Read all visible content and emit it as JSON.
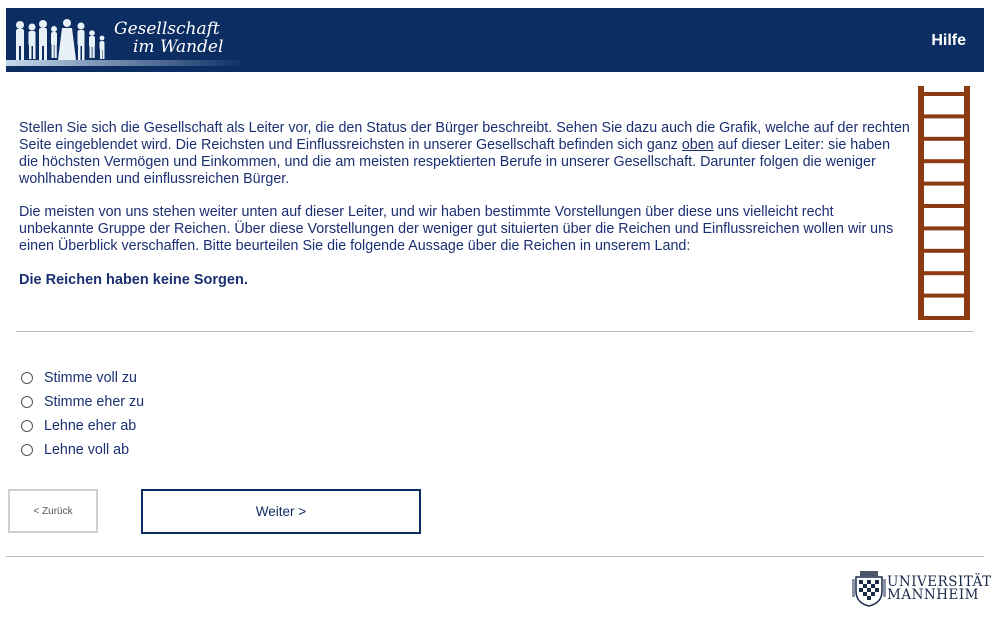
{
  "header": {
    "logo_line1": "Gesellschaft",
    "logo_line2": "im Wandel",
    "help_label": "Hilfe",
    "background_color": "#0c2d62"
  },
  "intro": {
    "p1_before": "Stellen Sie sich die Gesellschaft als Leiter vor, die den Status der Bürger beschreibt. Sehen Sie dazu auch die Grafik, welche auf der rechten Seite eingeblendet wird. Die Reichsten und Einflussreichsten in unserer Gesellschaft befinden sich ganz ",
    "p1_underlined": "oben",
    "p1_after": " auf dieser Leiter: sie haben die höchsten Vermögen und Einkommen, und die am meisten respektierten Berufe in unserer Gesellschaft. Darunter folgen die weniger wohlhabenden und einflussreichen Bürger.",
    "p2": "Die meisten von uns stehen weiter unten auf dieser Leiter, und wir haben bestimmte Vorstellungen über diese uns vielleicht recht unbekannte Gruppe der Reichen. Über diese Vorstellungen der weniger gut situierten über die Reichen und Einflussreichen wollen wir uns einen Überblick verschaffen. Bitte beurteilen Sie die folgende Aussage über die Reichen in unserem Land:"
  },
  "statement": "Die Reichen haben keine Sorgen.",
  "ladder": {
    "icon": "ladder-icon",
    "rung_count": 11,
    "color": "#8b3a12"
  },
  "options": [
    {
      "label": "Stimme voll zu"
    },
    {
      "label": "Stimme eher zu"
    },
    {
      "label": "Lehne eher ab"
    },
    {
      "label": "Lehne voll ab"
    }
  ],
  "buttons": {
    "back_label": "< Zurück",
    "next_label": "Weiter >"
  },
  "footer": {
    "university_line1": "UNIVERSITÄT",
    "university_line2": "MANNHEIM"
  }
}
